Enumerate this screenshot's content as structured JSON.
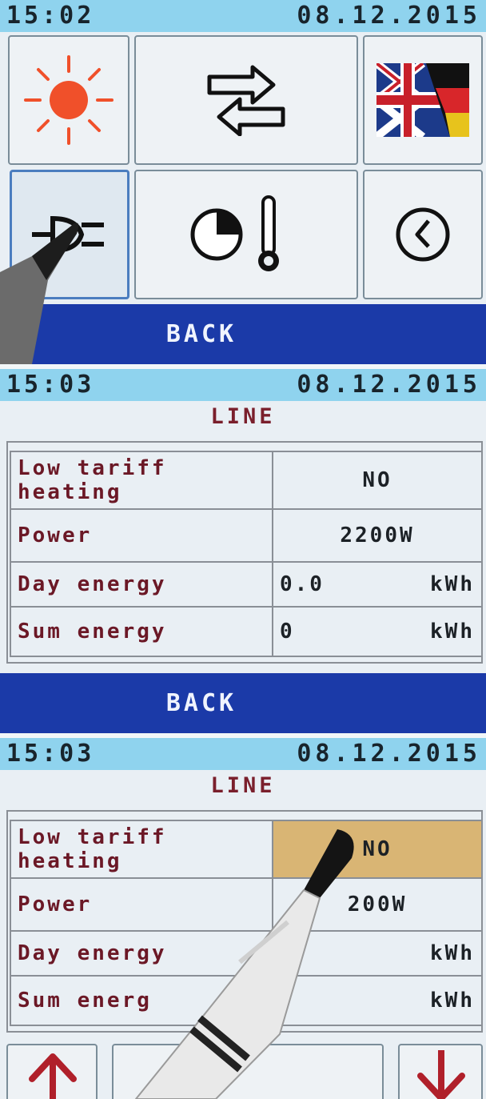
{
  "panels": [
    {
      "status": {
        "time": "15:02",
        "date": "08.12.2015"
      },
      "back_label": "BACK",
      "menu": [
        {
          "name": "brightness",
          "icon": "sun-icon"
        },
        {
          "name": "data-transfer",
          "icon": "exchange-arrows-icon"
        },
        {
          "name": "language",
          "icon": "uk-germany-flag-icon"
        },
        {
          "name": "line-power",
          "icon": "power-plug-icon",
          "selected": true
        },
        {
          "name": "timer-temperature",
          "icon": "pie-clock-thermometer-icon"
        },
        {
          "name": "clock",
          "icon": "clock-icon"
        }
      ]
    },
    {
      "status": {
        "time": "15:03",
        "date": "08.12.2015"
      },
      "title": "LINE",
      "rows": [
        {
          "label_1": "Low tariff",
          "label_2": "heating",
          "value": "NO"
        },
        {
          "label": "Power",
          "value": "2200W"
        },
        {
          "label": "Day energy",
          "value": "0.0",
          "unit": "kWh"
        },
        {
          "label": "Sum energy",
          "value": "0",
          "unit": "kWh"
        }
      ],
      "back_label": "BACK"
    },
    {
      "status": {
        "time": "15:03",
        "date": "08.12.2015"
      },
      "title": "LINE",
      "rows": [
        {
          "label_1": "Low tariff",
          "label_2": "heating",
          "value": "NO",
          "highlight": true
        },
        {
          "label": "Power",
          "value": "200W"
        },
        {
          "label": "Day energy",
          "unit": "kWh"
        },
        {
          "label": "Sum energ",
          "unit": "kWh"
        }
      ],
      "nav": [
        "up-arrow-icon",
        "down-arrow-icon"
      ]
    }
  ],
  "colors": {
    "status": "#8fd3ee",
    "back": "#1b3aa8",
    "label": "#6b1826",
    "highlight": "#d9b574",
    "arrow": "#b0202a"
  }
}
